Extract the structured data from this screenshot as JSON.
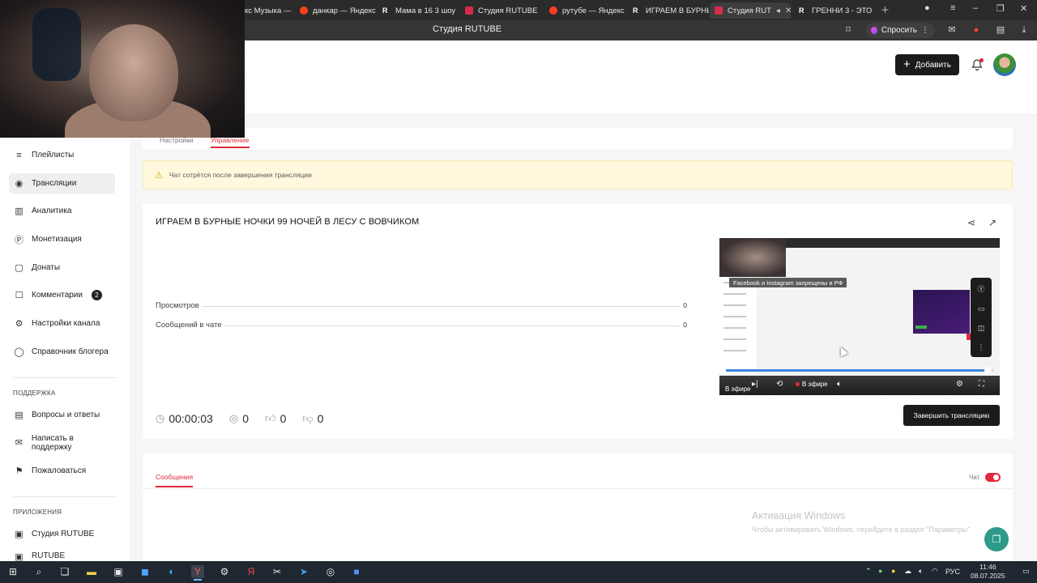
{
  "browser": {
    "tabs": [
      {
        "label": "кс Музыка — ",
        "icon": "r-icon"
      },
      {
        "label": "данкар — Яндекс",
        "icon": "yandex-icon"
      },
      {
        "label": "Мама в 16 3 шоу",
        "icon": "r-icon"
      },
      {
        "label": "Студия RUTUBE",
        "icon": "rutube-icon"
      },
      {
        "label": "рутубе — Яндекс",
        "icon": "yandex-icon"
      },
      {
        "label": "ИГРАЕМ В БУРНЫ",
        "icon": "r-icon"
      },
      {
        "label": "Студия RUT",
        "icon": "rutube-icon",
        "active": true
      },
      {
        "label": "ГРЕННИ 3 - ЭТО",
        "icon": "r-icon"
      }
    ],
    "page_title": "Студия RUTUBE",
    "ask_label": "Спросить"
  },
  "header": {
    "add_label": "Добавить"
  },
  "sidebar": {
    "items": [
      {
        "label": "Плейлисты",
        "icon": "playlist-icon"
      },
      {
        "label": "Трансляции",
        "icon": "broadcast-icon",
        "active": true
      },
      {
        "label": "Аналитика",
        "icon": "analytics-icon"
      },
      {
        "label": "Монетизация",
        "icon": "monetization-icon"
      },
      {
        "label": "Донаты",
        "icon": "donate-icon"
      },
      {
        "label": "Комментарии",
        "icon": "comment-icon",
        "badge": "2"
      },
      {
        "label": "Настройки канала",
        "icon": "settings-icon"
      },
      {
        "label": "Справочник блогера",
        "icon": "help-book-icon"
      }
    ],
    "support_title": "ПОДДЕРЖКА",
    "support_items": [
      {
        "label": "Вопросы и ответы",
        "icon": "faq-icon"
      },
      {
        "label": "Написать в поддержку",
        "icon": "mail-icon"
      },
      {
        "label": "Пожаловаться",
        "icon": "flag-icon"
      }
    ],
    "apps_title": "ПРИЛОЖЕНИЯ",
    "apps_items": [
      {
        "label": "Студия RUTUBE",
        "icon": "rutube-icon"
      },
      {
        "label": "RUTUBE",
        "icon": "rutube-icon"
      }
    ]
  },
  "tabs": {
    "settings": "Настройки",
    "manage": "Управление"
  },
  "notice": {
    "text": "Чат сотрётся после завершения трансляции"
  },
  "stream": {
    "title": "ИГРАЕМ В БУРНЫЕ НОЧКИ 99 НОЧЕЙ В ЛЕСУ С ВОВЧИКОМ",
    "stats": [
      {
        "label": "Просмотров",
        "value": "0"
      },
      {
        "label": "Сообщений в чате",
        "value": "0"
      }
    ],
    "duration": "00:00:03",
    "viewers": "0",
    "likes": "0",
    "dislikes": "0",
    "end_label": "Завершить трансляцию"
  },
  "player": {
    "toast": "Facebook и Instagram запрещены в РФ",
    "live_label": "В эфире",
    "live_label_small": "В эфире",
    "progress": 0.98
  },
  "chat": {
    "tab_label": "Сообщения",
    "toggle_label": "Чат",
    "enabled": true
  },
  "windows_activation": {
    "title": "Активация Windows",
    "subtitle": "Чтобы активировать Windows, перейдите в раздел \"Параметры\""
  },
  "taskbar": {
    "lang": "РУС",
    "time": "11:46",
    "date": "08.07.2025"
  },
  "colors": {
    "accent": "#e0293c",
    "dark_button": "#1b1b1b",
    "notice_bg": "#fff8dc"
  }
}
